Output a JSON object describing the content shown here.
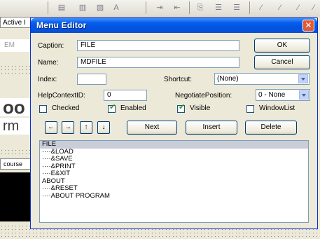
{
  "background": {
    "active_label": "Active I",
    "em_label": "EM",
    "big_text_1": "oo",
    "big_text_2": "rm",
    "course_label": "course",
    "toolbar_icons": [
      "align-left-icon",
      "align-center-icon",
      "format-icon",
      "font-size-icon",
      "indent-icon",
      "outdent-icon",
      "bookmark-icon",
      "list-icon",
      "list-icon",
      "bold-icon",
      "italic-icon",
      "underline-icon"
    ]
  },
  "dialog": {
    "title": "Menu Editor",
    "close_glyph": "✕",
    "caption_label": "Caption:",
    "caption_value": "FILE",
    "name_label": "Name:",
    "name_value": "MDFILE",
    "index_label": "Index:",
    "index_value": "",
    "shortcut_label": "Shortcut:",
    "shortcut_value": "(None)",
    "helpcontext_label": "HelpContextID:",
    "helpcontext_value": "0",
    "negotiate_label": "NegotiatePosition:",
    "negotiate_value": "0 - None",
    "ok_label": "OK",
    "cancel_label": "Cancel",
    "checkboxes": {
      "checked": {
        "label": "Checked",
        "value": false
      },
      "enabled": {
        "label": "Enabled",
        "value": true
      },
      "visible": {
        "label": "Visible",
        "value": true
      },
      "windowlist": {
        "label": "WindowList",
        "value": false
      }
    },
    "arrows": {
      "left": "←",
      "right": "→",
      "up": "↑",
      "down": "↓"
    },
    "next_label": "Next",
    "insert_label": "Insert",
    "delete_label": "Delete",
    "menu_items": [
      "FILE",
      "····&LOAD",
      "····&SAVE",
      "····&PRINT",
      "····E&XIT",
      "ABOUT",
      "····&RESET",
      "····ABOUT PROGRAM"
    ]
  }
}
